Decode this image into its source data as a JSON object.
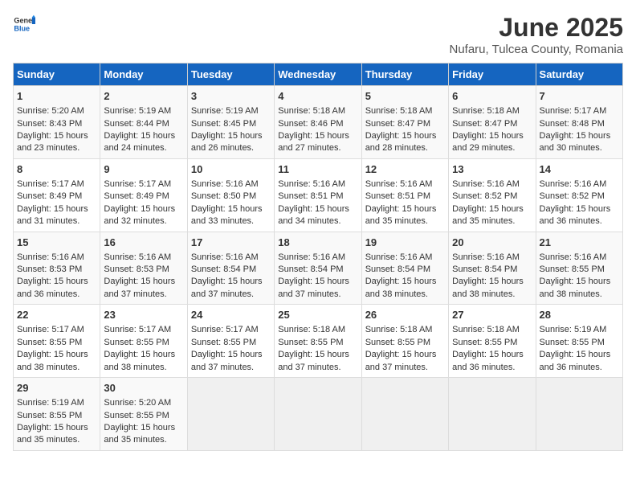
{
  "logo": {
    "text_general": "General",
    "text_blue": "Blue"
  },
  "title": "June 2025",
  "subtitle": "Nufaru, Tulcea County, Romania",
  "days_of_week": [
    "Sunday",
    "Monday",
    "Tuesday",
    "Wednesday",
    "Thursday",
    "Friday",
    "Saturday"
  ],
  "weeks": [
    [
      {
        "day": "1",
        "info": "Sunrise: 5:20 AM\nSunset: 8:43 PM\nDaylight: 15 hours and 23 minutes."
      },
      {
        "day": "2",
        "info": "Sunrise: 5:19 AM\nSunset: 8:44 PM\nDaylight: 15 hours and 24 minutes."
      },
      {
        "day": "3",
        "info": "Sunrise: 5:19 AM\nSunset: 8:45 PM\nDaylight: 15 hours and 26 minutes."
      },
      {
        "day": "4",
        "info": "Sunrise: 5:18 AM\nSunset: 8:46 PM\nDaylight: 15 hours and 27 minutes."
      },
      {
        "day": "5",
        "info": "Sunrise: 5:18 AM\nSunset: 8:47 PM\nDaylight: 15 hours and 28 minutes."
      },
      {
        "day": "6",
        "info": "Sunrise: 5:18 AM\nSunset: 8:47 PM\nDaylight: 15 hours and 29 minutes."
      },
      {
        "day": "7",
        "info": "Sunrise: 5:17 AM\nSunset: 8:48 PM\nDaylight: 15 hours and 30 minutes."
      }
    ],
    [
      {
        "day": "8",
        "info": "Sunrise: 5:17 AM\nSunset: 8:49 PM\nDaylight: 15 hours and 31 minutes."
      },
      {
        "day": "9",
        "info": "Sunrise: 5:17 AM\nSunset: 8:49 PM\nDaylight: 15 hours and 32 minutes."
      },
      {
        "day": "10",
        "info": "Sunrise: 5:16 AM\nSunset: 8:50 PM\nDaylight: 15 hours and 33 minutes."
      },
      {
        "day": "11",
        "info": "Sunrise: 5:16 AM\nSunset: 8:51 PM\nDaylight: 15 hours and 34 minutes."
      },
      {
        "day": "12",
        "info": "Sunrise: 5:16 AM\nSunset: 8:51 PM\nDaylight: 15 hours and 35 minutes."
      },
      {
        "day": "13",
        "info": "Sunrise: 5:16 AM\nSunset: 8:52 PM\nDaylight: 15 hours and 35 minutes."
      },
      {
        "day": "14",
        "info": "Sunrise: 5:16 AM\nSunset: 8:52 PM\nDaylight: 15 hours and 36 minutes."
      }
    ],
    [
      {
        "day": "15",
        "info": "Sunrise: 5:16 AM\nSunset: 8:53 PM\nDaylight: 15 hours and 36 minutes."
      },
      {
        "day": "16",
        "info": "Sunrise: 5:16 AM\nSunset: 8:53 PM\nDaylight: 15 hours and 37 minutes."
      },
      {
        "day": "17",
        "info": "Sunrise: 5:16 AM\nSunset: 8:54 PM\nDaylight: 15 hours and 37 minutes."
      },
      {
        "day": "18",
        "info": "Sunrise: 5:16 AM\nSunset: 8:54 PM\nDaylight: 15 hours and 37 minutes."
      },
      {
        "day": "19",
        "info": "Sunrise: 5:16 AM\nSunset: 8:54 PM\nDaylight: 15 hours and 38 minutes."
      },
      {
        "day": "20",
        "info": "Sunrise: 5:16 AM\nSunset: 8:54 PM\nDaylight: 15 hours and 38 minutes."
      },
      {
        "day": "21",
        "info": "Sunrise: 5:16 AM\nSunset: 8:55 PM\nDaylight: 15 hours and 38 minutes."
      }
    ],
    [
      {
        "day": "22",
        "info": "Sunrise: 5:17 AM\nSunset: 8:55 PM\nDaylight: 15 hours and 38 minutes."
      },
      {
        "day": "23",
        "info": "Sunrise: 5:17 AM\nSunset: 8:55 PM\nDaylight: 15 hours and 38 minutes."
      },
      {
        "day": "24",
        "info": "Sunrise: 5:17 AM\nSunset: 8:55 PM\nDaylight: 15 hours and 37 minutes."
      },
      {
        "day": "25",
        "info": "Sunrise: 5:18 AM\nSunset: 8:55 PM\nDaylight: 15 hours and 37 minutes."
      },
      {
        "day": "26",
        "info": "Sunrise: 5:18 AM\nSunset: 8:55 PM\nDaylight: 15 hours and 37 minutes."
      },
      {
        "day": "27",
        "info": "Sunrise: 5:18 AM\nSunset: 8:55 PM\nDaylight: 15 hours and 36 minutes."
      },
      {
        "day": "28",
        "info": "Sunrise: 5:19 AM\nSunset: 8:55 PM\nDaylight: 15 hours and 36 minutes."
      }
    ],
    [
      {
        "day": "29",
        "info": "Sunrise: 5:19 AM\nSunset: 8:55 PM\nDaylight: 15 hours and 35 minutes."
      },
      {
        "day": "30",
        "info": "Sunrise: 5:20 AM\nSunset: 8:55 PM\nDaylight: 15 hours and 35 minutes."
      },
      {
        "day": "",
        "info": ""
      },
      {
        "day": "",
        "info": ""
      },
      {
        "day": "",
        "info": ""
      },
      {
        "day": "",
        "info": ""
      },
      {
        "day": "",
        "info": ""
      }
    ]
  ]
}
